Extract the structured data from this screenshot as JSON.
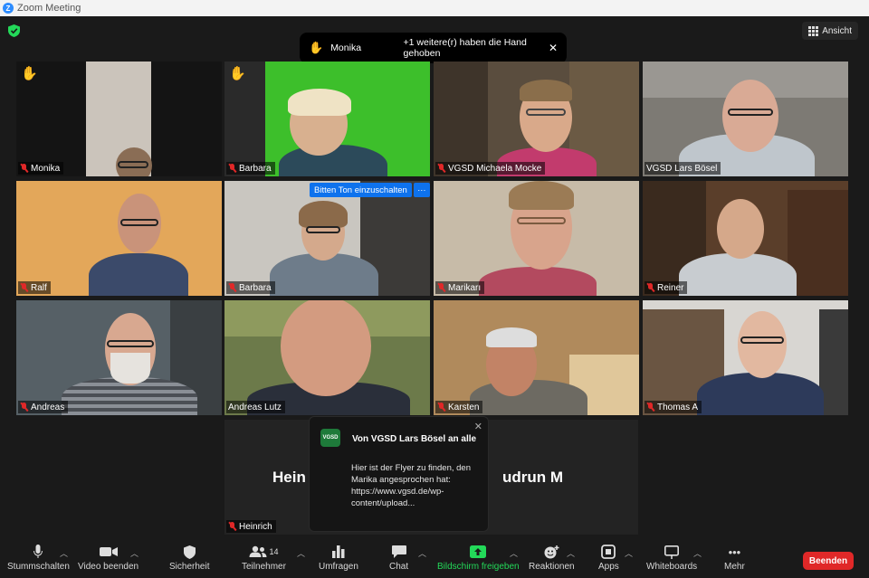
{
  "window": {
    "title": "Zoom Meeting",
    "logo": "Z"
  },
  "view_button": {
    "label": "Ansicht"
  },
  "hand_banner": {
    "name": "Monika",
    "text": "+1 weitere(r) haben die Hand gehoben",
    "close": "✕"
  },
  "unmute_request": {
    "label": "Bitten Ton einzuschalten",
    "more": "···"
  },
  "participants": [
    {
      "name": "Monika",
      "hand_raised": true,
      "muted": true
    },
    {
      "name": "Barbara",
      "hand_raised": true,
      "muted": true
    },
    {
      "name": "VGSD Michaela Mocke",
      "muted": true
    },
    {
      "name": "VGSD Lars Bösel",
      "muted": false
    },
    {
      "name": "Ralf",
      "muted": true
    },
    {
      "name": "Barbara",
      "muted": true
    },
    {
      "name": "Marikarı",
      "muted": true
    },
    {
      "name": "Reiner",
      "muted": true
    },
    {
      "name": "Andreas",
      "muted": true
    },
    {
      "name": "Andreas Lutz",
      "muted": false,
      "active_speaker": true
    },
    {
      "name": "Karsten",
      "muted": true
    },
    {
      "name": "Thomas A",
      "muted": true
    }
  ],
  "bottom_tile": {
    "left_name": "Hein",
    "right_name": "udrun M",
    "plate": "Heinrich"
  },
  "chat_popup": {
    "logo": "VGSD",
    "from": "Von VGSD Lars Bösel an alle",
    "message": "Hier ist der Flyer  zu finden, den Marika angesprochen hat: https://www.vgsd.de/wp-content/upload...",
    "close": "✕"
  },
  "toolbar": {
    "mute": "Stummschalten",
    "video": "Video beenden",
    "security": "Sicherheit",
    "participants": "Teilnehmer",
    "participants_count": "14",
    "polls": "Umfragen",
    "chat": "Chat",
    "share": "Bildschirm freigeben",
    "reactions": "Reaktionen",
    "apps": "Apps",
    "whiteboards": "Whiteboards",
    "more": "Mehr",
    "end": "Beenden"
  },
  "colors": {
    "end_red": "#e02828",
    "share_green": "#23d959",
    "active_outline": "#c6e36b",
    "request_blue": "#0e72ed"
  }
}
